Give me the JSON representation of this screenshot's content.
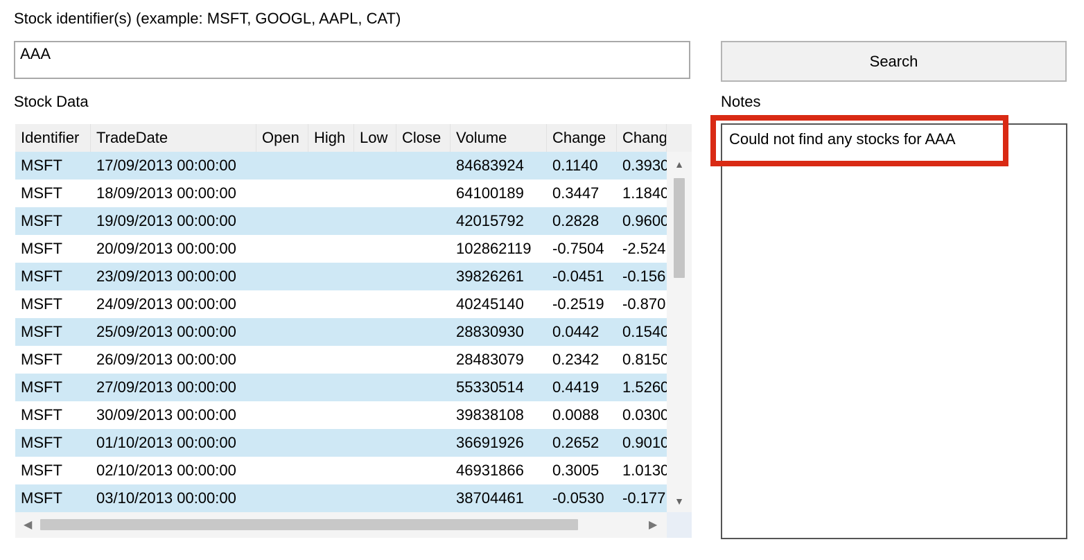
{
  "form": {
    "stock_label": "Stock identifier(s) (example: MSFT, GOOGL, AAPL, CAT)",
    "stock_input_value": "AAA",
    "search_label": "Search",
    "stock_data_label": "Stock Data",
    "notes_label": "Notes"
  },
  "grid": {
    "columns": [
      "Identifier",
      "TradeDate",
      "Open",
      "High",
      "Low",
      "Close",
      "Volume",
      "Change",
      "Chang"
    ],
    "rows": [
      [
        "MSFT",
        "17/09/2013 00:00:00",
        "",
        "",
        "",
        "",
        "84683924",
        "0.1140",
        "0.3930"
      ],
      [
        "MSFT",
        "18/09/2013 00:00:00",
        "",
        "",
        "",
        "",
        "64100189",
        "0.3447",
        "1.1840"
      ],
      [
        "MSFT",
        "19/09/2013 00:00:00",
        "",
        "",
        "",
        "",
        "42015792",
        "0.2828",
        "0.9600"
      ],
      [
        "MSFT",
        "20/09/2013 00:00:00",
        "",
        "",
        "",
        "",
        "102862119",
        "-0.7504",
        "-2.524"
      ],
      [
        "MSFT",
        "23/09/2013 00:00:00",
        "",
        "",
        "",
        "",
        "39826261",
        "-0.0451",
        "-0.156"
      ],
      [
        "MSFT",
        "24/09/2013 00:00:00",
        "",
        "",
        "",
        "",
        "40245140",
        "-0.2519",
        "-0.870"
      ],
      [
        "MSFT",
        "25/09/2013 00:00:00",
        "",
        "",
        "",
        "",
        "28830930",
        "0.0442",
        "0.1540"
      ],
      [
        "MSFT",
        "26/09/2013 00:00:00",
        "",
        "",
        "",
        "",
        "28483079",
        "0.2342",
        "0.8150"
      ],
      [
        "MSFT",
        "27/09/2013 00:00:00",
        "",
        "",
        "",
        "",
        "55330514",
        "0.4419",
        "1.5260"
      ],
      [
        "MSFT",
        "30/09/2013 00:00:00",
        "",
        "",
        "",
        "",
        "39838108",
        "0.0088",
        "0.0300"
      ],
      [
        "MSFT",
        "01/10/2013 00:00:00",
        "",
        "",
        "",
        "",
        "36691926",
        "0.2652",
        "0.9010"
      ],
      [
        "MSFT",
        "02/10/2013 00:00:00",
        "",
        "",
        "",
        "",
        "46931866",
        "0.3005",
        "1.0130"
      ],
      [
        "MSFT",
        "03/10/2013 00:00:00",
        "",
        "",
        "",
        "",
        "38704461",
        "-0.0530",
        "-0.177"
      ]
    ],
    "row_alt_color": "#cfe8f5"
  },
  "notes": {
    "text": "Could not find any stocks for AAA",
    "highlight_color": "#d92a14"
  },
  "icons": {
    "scroll_up": "▲",
    "scroll_down": "▼",
    "scroll_left": "◀",
    "scroll_right": "▶"
  }
}
